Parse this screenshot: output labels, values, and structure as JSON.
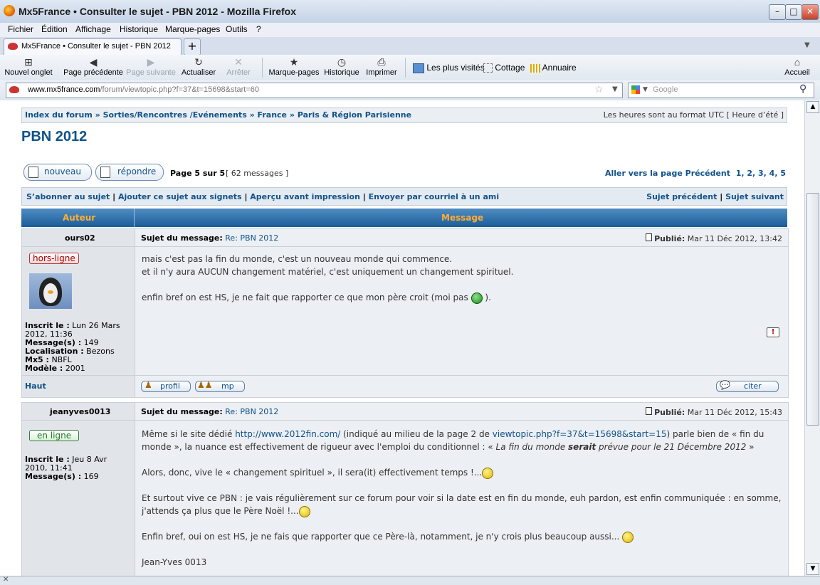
{
  "window": {
    "title": "Mx5France • Consulter le sujet - PBN 2012 - Mozilla Firefox"
  },
  "menu": [
    "Fichier",
    "Édition",
    "Affichage",
    "Historique",
    "Marque-pages",
    "Outils",
    "?"
  ],
  "tab": {
    "label": "Mx5France • Consulter le sujet - PBN 2012"
  },
  "toolbar": {
    "new_tab": "Nouvel onglet",
    "prev": "Page précédente",
    "next": "Page suivante",
    "reload": "Actualiser",
    "stop": "Arrêter",
    "bookmarks": "Marque-pages",
    "history": "Historique",
    "print": "Imprimer",
    "most_visited": "Les plus visités",
    "cottage": "Cottage",
    "annuaire": "Annuaire",
    "home": "Accueil"
  },
  "url": {
    "domain": "www.mx5france.com",
    "path": "/forum/viewtopic.php?f=37&t=15698&start=60"
  },
  "search": {
    "placeholder": "Google"
  },
  "forum": {
    "breadcrumb": [
      "Index du forum",
      "Sorties/Rencontres /Evénements",
      "France",
      "Paris & Région Parisienne"
    ],
    "timezone": "Les heures sont au format UTC [ Heure d’été ]",
    "topic_title": "PBN 2012",
    "btn_new": "nouveau",
    "btn_reply": "répondre",
    "page_info": "Page 5 sur 5",
    "msg_count": "[ 62 messages ]",
    "goto_label": "Aller vers la page",
    "goto_prev": "Précédent",
    "pages": "1, 2, 3, 4, 5",
    "opt_links": [
      "S’abonner au sujet",
      "Ajouter ce sujet aux signets",
      "Aperçu avant impression",
      "Envoyer par courriel à un ami"
    ],
    "nav_links": [
      "Sujet précédent",
      "Sujet suivant"
    ],
    "col_author": "Auteur",
    "col_message": "Message",
    "subject_label": "Sujet du message:",
    "published_label": "Publié:",
    "top_link": "Haut",
    "posts": [
      {
        "author": "ours02",
        "subject": "Re: PBN 2012",
        "date": "Mar 11 Déc 2012, 13:42",
        "status": "hors-ligne",
        "registered_label": "Inscrit le :",
        "registered": "Lun 26 Mars 2012, 11:36",
        "messages_label": "Message(s) :",
        "messages": "149",
        "location_label": "Localisation :",
        "location": "Bezons",
        "mx5_label": "Mx5 :",
        "mx5": "NBFL",
        "model_label": "Modèle :",
        "model": "2001",
        "lines": [
          "mais c'est pas la fin du monde, c'est un nouveau monde qui commence.",
          "et il n'y aura AUCUN changement matériel, c'est uniquement un changement spirituel.",
          "enfin bref on est HS, je ne fait que rapporter ce que mon père croit (moi pas",
          ")."
        ],
        "btn_profile": "profil",
        "btn_pm": "mp",
        "btn_quote": "citer"
      },
      {
        "author": "jeanyves0013",
        "subject": "Re: PBN 2012",
        "date": "Mar 11 Déc 2012, 15:43",
        "status": "en ligne",
        "registered_label": "Inscrit le :",
        "registered": "Jeu 8 Avr 2010, 11:41",
        "messages_label": "Message(s) :",
        "messages": "169",
        "p1a": "Même si le site dédié ",
        "link1": "http://www.2012fin.com/",
        "p1b": " (indiqué au milieu de la page 2 de ",
        "link2": "viewtopic.php?f=37&t=15698&start=15",
        "p1c": ") parle bien de « fin du",
        "p1d": "monde », la nuance est effectivement de rigueur avec l'emploi du conditionnel : « ",
        "p1e": "La fin du monde ",
        "p1f": "serait",
        "p1g": " prévue pour le 21 Décembre 2012",
        "p1h": " »",
        "p2": "Alors, donc, vive le « changement spirituel », il sera(it) effectivement temps !...",
        "p3a": "Et surtout vive ce PBN : je vais régulièrement sur ce forum pour voir si la date est en fin du monde, euh pardon, est enfin communiquée : en somme,",
        "p3b": "j'attends ça plus que le Père Noël !...",
        "p4": "Enfin bref, oui on est HS, je ne fais que rapporter que ce Père-là, notamment, je n'y crois plus beaucoup aussi...",
        "p5": "Jean-Yves 0013"
      }
    ]
  },
  "colors": {
    "link": "#105289",
    "header_gradient_top": "#4f8cc2",
    "header_gradient_bottom": "#1b5d98",
    "header_text": "#ffad33"
  }
}
